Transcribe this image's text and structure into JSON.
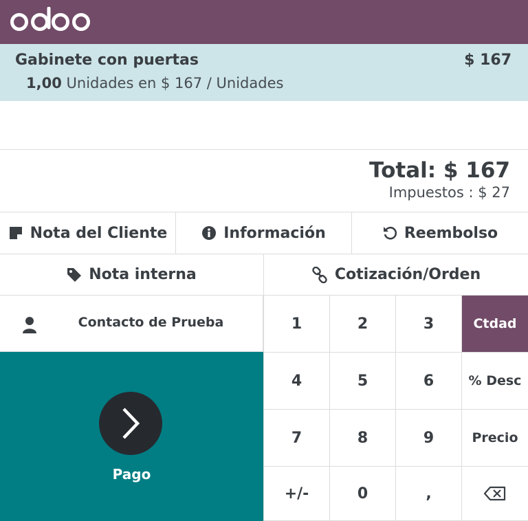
{
  "header": {
    "logo_text": "odoo",
    "brand_color": "#714b67"
  },
  "order_line": {
    "product": "Gabinete con puertas",
    "price": "$ 167",
    "quantity": "1,00",
    "unit_detail": "Unidades en $ 167 / Unidades"
  },
  "summary": {
    "total": "Total: $ 167",
    "taxes": "Impuestos : $ 27"
  },
  "actions_row1": [
    {
      "label": "Nota del Cliente",
      "icon": "note-icon"
    },
    {
      "label": "Información",
      "icon": "info-icon"
    },
    {
      "label": "Reembolso",
      "icon": "undo-icon"
    }
  ],
  "actions_row2": [
    {
      "label": "Nota interna",
      "icon": "tag-icon"
    },
    {
      "label": "Cotización/Orden",
      "icon": "link-icon"
    }
  ],
  "customer": {
    "name": "Contacto de Prueba",
    "icon": "user-icon"
  },
  "payment": {
    "label": "Pago",
    "color": "#017e84"
  },
  "numpad": {
    "rows": [
      [
        "1",
        "2",
        "3",
        "Ctdad"
      ],
      [
        "4",
        "5",
        "6",
        "% Desc"
      ],
      [
        "7",
        "8",
        "9",
        "Precio"
      ],
      [
        "+/-",
        "0",
        ","
      ]
    ],
    "active_mode": "Ctdad",
    "backspace_icon": "backspace-icon"
  }
}
